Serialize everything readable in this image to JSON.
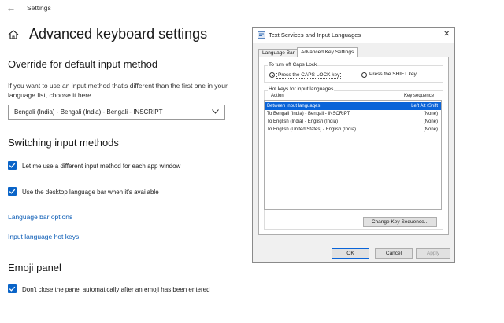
{
  "window": {
    "back_glyph": "←",
    "title": "Settings"
  },
  "page": {
    "title": "Advanced keyboard settings"
  },
  "override": {
    "heading": "Override for default input method",
    "description": "If you want to use an input method that's different than the first one in your language list, choose it here",
    "selected": "Bengali (India) - Bengali (India) - Bengali - INSCRIPT"
  },
  "switching": {
    "heading": "Switching input methods",
    "checkbox1": "Let me use a different input method for each app window",
    "checkbox2": "Use the desktop language bar when it's available",
    "link1": "Language bar options",
    "link2": "Input language hot keys"
  },
  "emoji": {
    "heading": "Emoji panel",
    "checkbox": "Don't close the panel automatically after an emoji has been entered"
  },
  "dialog": {
    "title": "Text Services and Input Languages",
    "close_glyph": "✕",
    "tabs": [
      "Language Bar",
      "Advanced Key Settings"
    ],
    "caps_group": "To turn off Caps Lock",
    "radio1": "Press the CAPS LOCK key",
    "radio2": "Press the SHIFT key",
    "hotkeys_group": "Hot keys for input languages",
    "col_action": "Action",
    "col_key": "Key sequence",
    "rows": [
      {
        "action": "Between input languages",
        "key": "Left Alt+Shift"
      },
      {
        "action": "To Bengali (India) - Bengali - INSCRIPT",
        "key": "(None)"
      },
      {
        "action": "To English (India) - English (India)",
        "key": "(None)"
      },
      {
        "action": "To English (United States) - English (India)",
        "key": "(None)"
      }
    ],
    "change_btn": "Change Key Sequence...",
    "ok": "OK",
    "cancel": "Cancel",
    "apply": "Apply"
  },
  "colors": {
    "accent": "#0a64c8",
    "link": "#0a5bb5",
    "selection": "#0a64d8"
  }
}
